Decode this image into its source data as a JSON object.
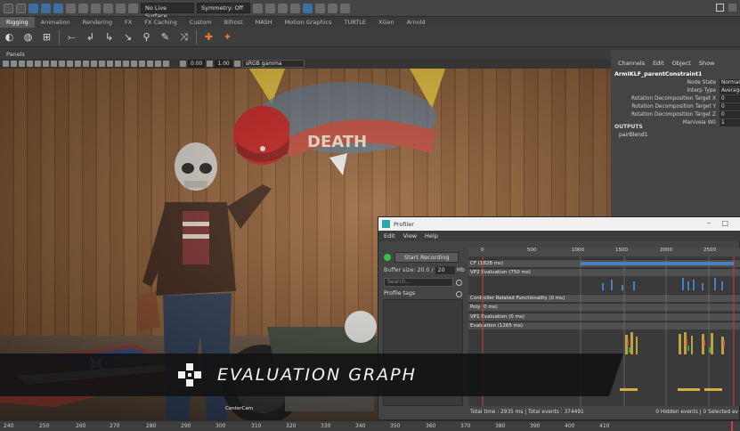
{
  "status_bar": {
    "live_surface": "No Live Surface",
    "symmetry": "Symmetry: Off"
  },
  "shelf_tabs": [
    "Rigging",
    "Animation",
    "Rendering",
    "FX",
    "FX Caching",
    "Custom",
    "Bifrost",
    "MASH",
    "Motion Graphics",
    "TURTLE",
    "XGen",
    "Arnold"
  ],
  "panels_menu": "Panels",
  "viewport_toolbar": {
    "field1": "0.00",
    "field2": "1.00",
    "color_space": "sRGB gamma"
  },
  "viewport": {
    "camera_label": "CenterCam"
  },
  "channel_box": {
    "menu": [
      "Channels",
      "Edit",
      "Object",
      "Show"
    ],
    "node_name": "ArmIKLF_parentConstraint1",
    "attributes": [
      {
        "label": "Node State",
        "value": "Normal"
      },
      {
        "label": "Interp Type",
        "value": "Average"
      },
      {
        "label": "Rotation Decomposition Target X",
        "value": "0"
      },
      {
        "label": "Rotation Decomposition Target Y",
        "value": "0"
      },
      {
        "label": "Rotation Decomposition Target Z",
        "value": "0"
      },
      {
        "label": "Manivela W0",
        "value": "1"
      }
    ],
    "outputs_label": "OUTPUTS",
    "output_node": "pairBlend1"
  },
  "profiler": {
    "title": "Profiler",
    "menu": [
      "Edit",
      "View",
      "Help"
    ],
    "start_recording": "Start Recording",
    "buffer_label": "Buffer size: 20.0 /",
    "buffer_value": "20",
    "buffer_unit": "Mb",
    "search_placeholder": "Search...",
    "profile_tags": "Profile tags",
    "ruler_ticks": [
      "0",
      "500",
      "1000",
      "1500",
      "2000",
      "2500"
    ],
    "tracks": [
      {
        "label": "CF (1828 ms)"
      },
      {
        "label": "VP2 Evaluation (750 ms)"
      },
      {
        "label": "Controller Related Functionality (0 ms)"
      },
      {
        "label": "Poly (0 ms)"
      },
      {
        "label": "VP1 Evaluation (0 ms)"
      },
      {
        "label": "Evaluation (1265 ms)"
      }
    ],
    "total_time": "Total time : 2935 ms | Total events : 374491",
    "hidden_events": "0 Hidden events | 0 Selected ev"
  },
  "banner": {
    "title": "EVALUATION GRAPH"
  },
  "time_slider": {
    "ticks": [
      "240",
      "250",
      "260",
      "270",
      "280",
      "290",
      "300",
      "310",
      "320",
      "330",
      "340",
      "350",
      "360",
      "370",
      "380",
      "390",
      "400",
      "410"
    ]
  },
  "colors": {
    "maya_accent": "#3d6fa0",
    "profiler_green": "#35c04a",
    "shelf_orange": "#f07a2a",
    "banner_bg": "#141414"
  }
}
